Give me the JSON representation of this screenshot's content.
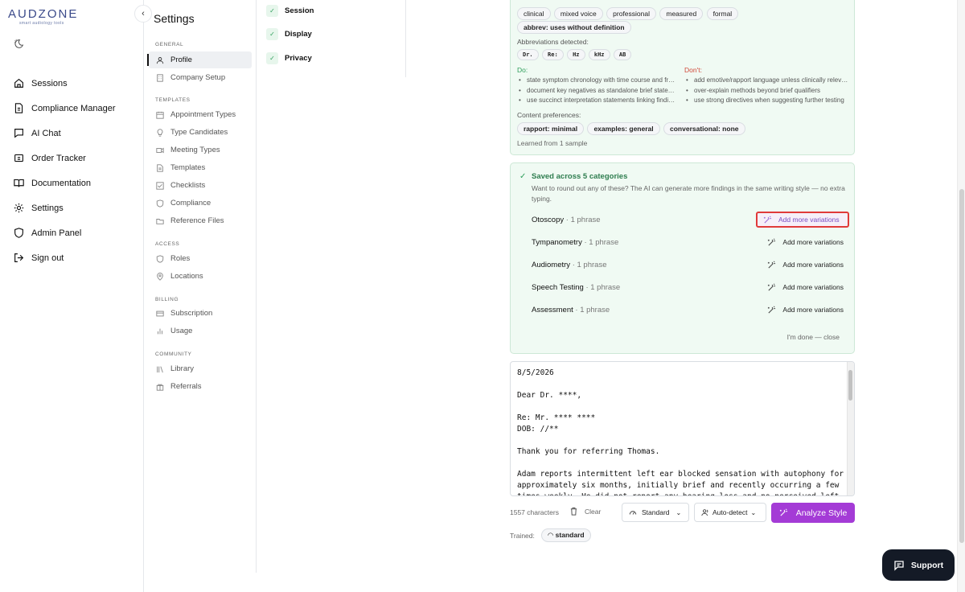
{
  "brand": {
    "name": "AUDZONE",
    "tagline": "smart audiology tools"
  },
  "nav": {
    "items": [
      {
        "label": "Sessions",
        "icon": "home-icon"
      },
      {
        "label": "Compliance Manager",
        "icon": "document-icon"
      },
      {
        "label": "AI Chat",
        "icon": "chat-icon"
      },
      {
        "label": "Order Tracker",
        "icon": "truck-icon"
      },
      {
        "label": "Documentation",
        "icon": "book-icon"
      },
      {
        "label": "Settings",
        "icon": "gear-icon"
      },
      {
        "label": "Admin Panel",
        "icon": "shield-icon"
      },
      {
        "label": "Sign out",
        "icon": "sign-out-icon"
      }
    ]
  },
  "settings": {
    "title": "Settings",
    "sections": {
      "general": "GENERAL",
      "templates": "TEMPLATES",
      "access": "ACCESS",
      "billing": "BILLING",
      "community": "COMMUNITY"
    },
    "items": {
      "profile": "Profile",
      "company_setup": "Company Setup",
      "appointment_types": "Appointment Types",
      "type_candidates": "Type Candidates",
      "meeting_types": "Meeting Types",
      "templates": "Templates",
      "checklists": "Checklists",
      "compliance": "Compliance",
      "reference_files": "Reference Files",
      "roles": "Roles",
      "locations": "Locations",
      "subscription": "Subscription",
      "usage": "Usage",
      "library": "Library",
      "referrals": "Referrals"
    }
  },
  "subpanel": {
    "items": [
      "Session",
      "Display",
      "Privacy"
    ]
  },
  "style_card": {
    "tone_chips": [
      "clinical",
      "mixed voice",
      "professional",
      "measured",
      "formal"
    ],
    "abbrev_chip": "abbrev: uses without definition",
    "abbrev_label": "Abbreviations detected:",
    "abbreviations": [
      "Dr.",
      "Re:",
      "Hz",
      "kHz",
      "AB"
    ],
    "do_label": "Do:",
    "dont_label": "Don't:",
    "do_items": [
      "state symptom chronology with time course and frequency",
      "document key negatives as standalone brief statements",
      "use succinct interpretation statements linking findings"
    ],
    "dont_items": [
      "add emotive/rapport language unless clinically relevant",
      "over-explain methods beyond brief qualifiers",
      "use strong directives when suggesting further testing"
    ],
    "content_pref_label": "Content preferences:",
    "content_prefs": [
      "rapport: minimal",
      "examples: general",
      "conversational: none"
    ],
    "learned": "Learned from 1 sample"
  },
  "saved_card": {
    "title": "Saved across 5 categories",
    "description": "Want to round out any of these? The AI can generate more findings in the same writing style — no extra typing.",
    "add_label": "Add more variations",
    "categories": [
      {
        "name": "Otoscopy",
        "count": "· 1 phrase"
      },
      {
        "name": "Tympanometry",
        "count": "· 1 phrase"
      },
      {
        "name": "Audiometry",
        "count": "· 1 phrase"
      },
      {
        "name": "Speech Testing",
        "count": "· 1 phrase"
      },
      {
        "name": "Assessment",
        "count": "· 1 phrase"
      }
    ],
    "done": "I'm done — close"
  },
  "editor": {
    "text": "8/5/2026\n\nDear Dr. ****,\n\nRe: Mr. **** ****\nDOB: //**\n\nThank you for referring Thomas.\n\nAdam reports intermittent left ear blocked sensation with autophony for\napproximately six months, initially brief and recently occurring a few\ntimes weekly. He did not report any hearing loss and no perceived left"
  },
  "bottom": {
    "char_count": "1557 characters",
    "clear": "Clear",
    "mode": "Standard",
    "detect": "Auto-detect",
    "analyze": "Analyze Style",
    "trained_label": "Trained:",
    "trained_value": "standard"
  },
  "support": {
    "label": "Support"
  }
}
